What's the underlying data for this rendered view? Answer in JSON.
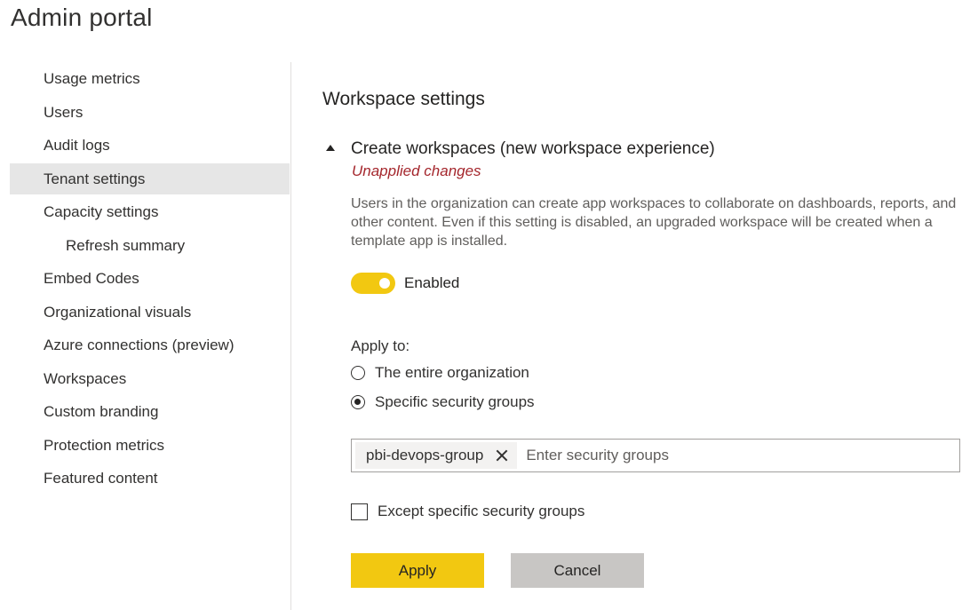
{
  "header": {
    "title": "Admin portal"
  },
  "sidebar": {
    "items": [
      {
        "label": "Usage metrics"
      },
      {
        "label": "Users"
      },
      {
        "label": "Audit logs"
      },
      {
        "label": "Tenant settings"
      },
      {
        "label": "Capacity settings"
      },
      {
        "label": "Refresh summary"
      },
      {
        "label": "Embed Codes"
      },
      {
        "label": "Organizational visuals"
      },
      {
        "label": "Azure connections (preview)"
      },
      {
        "label": "Workspaces"
      },
      {
        "label": "Custom branding"
      },
      {
        "label": "Protection metrics"
      },
      {
        "label": "Featured content"
      }
    ],
    "active": "Tenant settings"
  },
  "main": {
    "section_title": "Workspace settings",
    "setting": {
      "title": "Create workspaces (new workspace experience)",
      "status": "Unapplied changes",
      "description": "Users in the organization can create app workspaces to collaborate on dashboards, reports, and other content. Even if this setting is disabled, an upgraded workspace will be created when a template app is installed.",
      "toggle_label": "Enabled",
      "toggle_on": true,
      "apply_to_label": "Apply to:",
      "options": [
        {
          "label": "The entire organization",
          "selected": false
        },
        {
          "label": "Specific security groups",
          "selected": true
        }
      ],
      "groups": {
        "chips": [
          "pbi-devops-group"
        ],
        "placeholder": "Enter security groups"
      },
      "except_label": "Except specific security groups",
      "except_checked": false
    },
    "buttons": {
      "apply": "Apply",
      "cancel": "Cancel"
    }
  },
  "colors": {
    "accent": "#F2C811",
    "warning_text": "#A4262C",
    "active_nav_bg": "#E6E6E6",
    "cancel_bg": "#C8C6C4"
  }
}
